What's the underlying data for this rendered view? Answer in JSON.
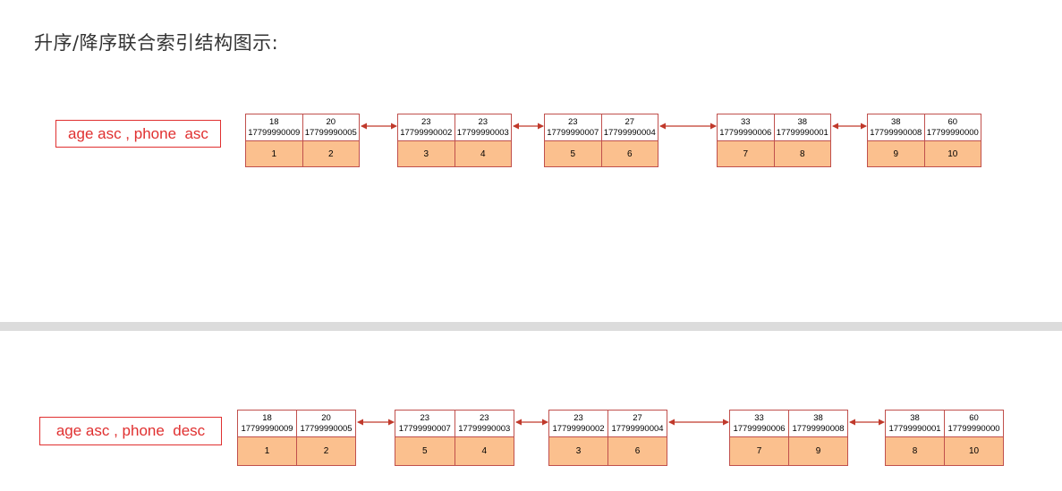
{
  "title": "升序/降序联合索引结构图示:",
  "colors": {
    "border": "#c0504d",
    "rowid_fill": "#fbc08e",
    "label_red": "#e03030",
    "arrow": "#c0392b"
  },
  "diagrams": [
    {
      "label": "age asc , phone  asc",
      "pages": [
        {
          "entries": [
            {
              "age": "18",
              "phone": "17799990009",
              "id": "1"
            },
            {
              "age": "20",
              "phone": "17799990005",
              "id": "2"
            }
          ]
        },
        {
          "entries": [
            {
              "age": "23",
              "phone": "17799990002",
              "id": "3"
            },
            {
              "age": "23",
              "phone": "17799990003",
              "id": "4"
            }
          ]
        },
        {
          "entries": [
            {
              "age": "23",
              "phone": "17799990007",
              "id": "5"
            },
            {
              "age": "27",
              "phone": "17799990004",
              "id": "6"
            }
          ]
        },
        {
          "entries": [
            {
              "age": "33",
              "phone": "17799990006",
              "id": "7"
            },
            {
              "age": "38",
              "phone": "17799990001",
              "id": "8"
            }
          ]
        },
        {
          "entries": [
            {
              "age": "38",
              "phone": "17799990008",
              "id": "9"
            },
            {
              "age": "60",
              "phone": "17799990000",
              "id": "10"
            }
          ]
        }
      ]
    },
    {
      "label": "age asc , phone  desc",
      "pages": [
        {
          "entries": [
            {
              "age": "18",
              "phone": "17799990009",
              "id": "1"
            },
            {
              "age": "20",
              "phone": "17799990005",
              "id": "2"
            }
          ]
        },
        {
          "entries": [
            {
              "age": "23",
              "phone": "17799990007",
              "id": "5"
            },
            {
              "age": "23",
              "phone": "17799990003",
              "id": "4"
            }
          ]
        },
        {
          "entries": [
            {
              "age": "23",
              "phone": "17799990002",
              "id": "3"
            },
            {
              "age": "27",
              "phone": "17799990004",
              "id": "6"
            }
          ]
        },
        {
          "entries": [
            {
              "age": "33",
              "phone": "17799990006",
              "id": "7"
            },
            {
              "age": "38",
              "phone": "17799990008",
              "id": "9"
            }
          ]
        },
        {
          "entries": [
            {
              "age": "38",
              "phone": "17799990001",
              "id": "8"
            },
            {
              "age": "60",
              "phone": "17799990000",
              "id": "10"
            }
          ]
        }
      ]
    }
  ]
}
